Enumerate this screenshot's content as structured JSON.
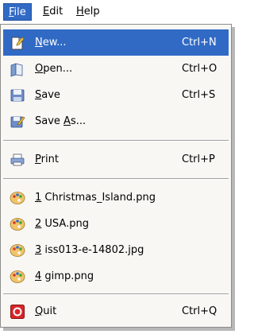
{
  "menubar": {
    "file": {
      "mnemonic": "F",
      "rest": "ile"
    },
    "edit": {
      "mnemonic": "E",
      "rest": "dit"
    },
    "help": {
      "mnemonic": "H",
      "rest": "elp"
    }
  },
  "menu": {
    "highlight_color": "#316ac5",
    "items": [
      {
        "mnemonic": "N",
        "rest": "ew...",
        "accel": "Ctrl+N",
        "icon": "new-file-icon",
        "highlighted": true
      },
      {
        "mnemonic": "O",
        "rest": "pen...",
        "accel": "Ctrl+O",
        "icon": "open-file-icon"
      },
      {
        "mnemonic": "S",
        "rest": "ave",
        "accel": "Ctrl+S",
        "icon": "save-icon"
      },
      {
        "pre": "Save ",
        "mnemonic": "A",
        "rest": "s...",
        "accel": "",
        "icon": "save-as-icon"
      },
      {
        "mnemonic": "P",
        "rest": "rint",
        "accel": "Ctrl+P",
        "icon": "printer-icon"
      },
      {
        "mnemonic": "1",
        "rest": " Christmas_Island.png",
        "accel": "",
        "icon": "palette-icon"
      },
      {
        "mnemonic": "2",
        "rest": " USA.png",
        "accel": "",
        "icon": "palette-icon"
      },
      {
        "mnemonic": "3",
        "rest": " iss013-e-14802.jpg",
        "accel": "",
        "icon": "palette-icon"
      },
      {
        "mnemonic": "4",
        "rest": " gimp.png",
        "accel": "",
        "icon": "palette-icon"
      },
      {
        "mnemonic": "Q",
        "rest": "uit",
        "accel": "Ctrl+Q",
        "icon": "quit-icon"
      }
    ]
  }
}
